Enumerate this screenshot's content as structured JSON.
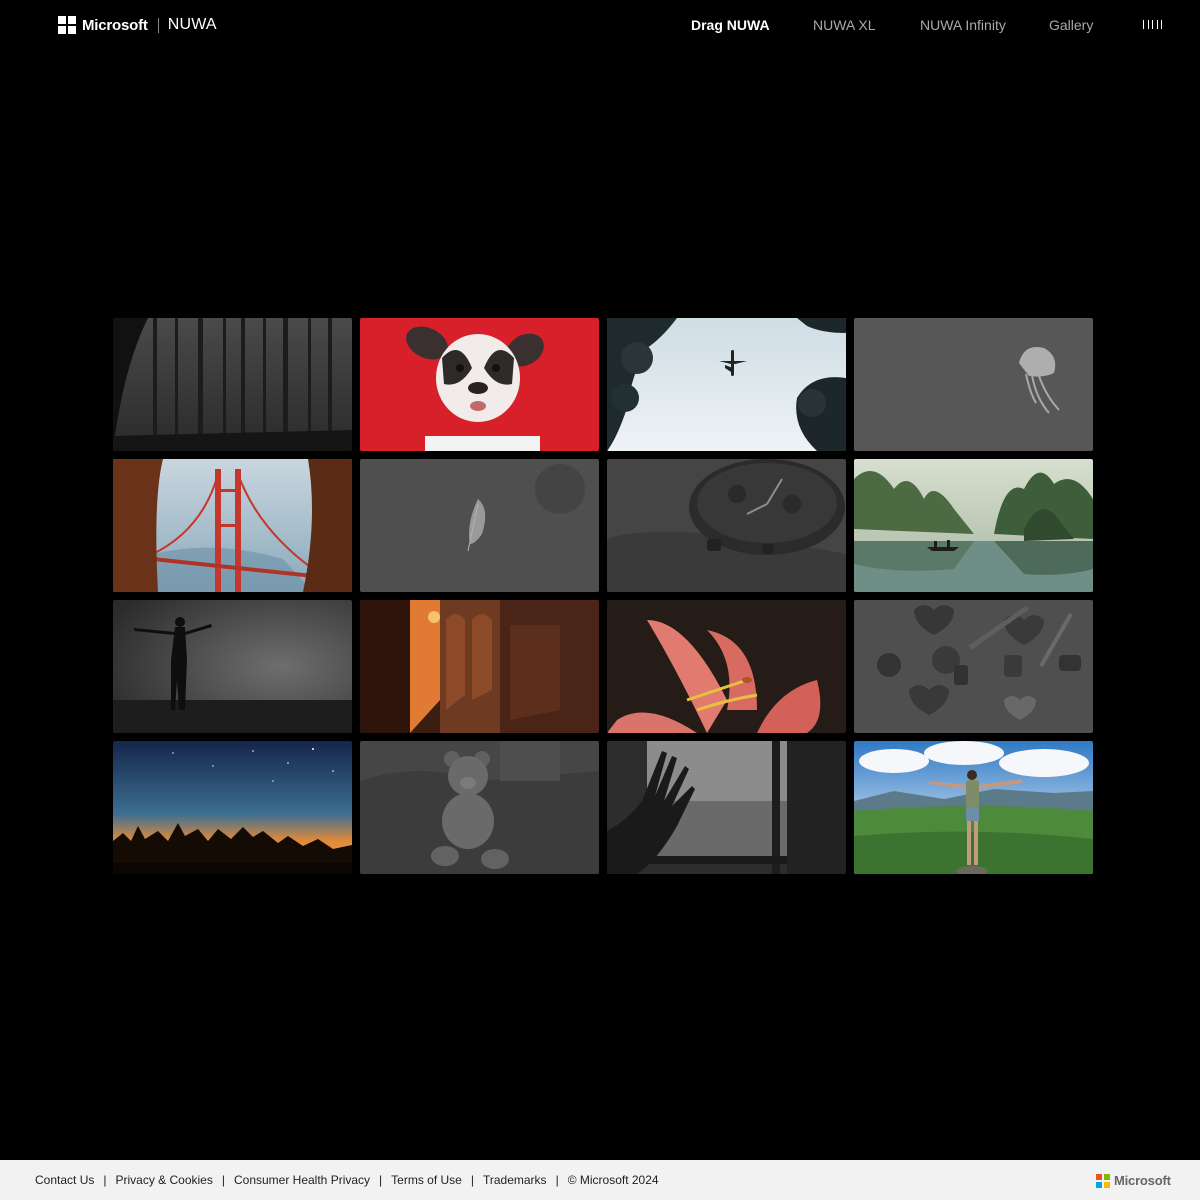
{
  "header": {
    "brand": "Microsoft",
    "product": "NUWA",
    "nav": [
      {
        "label": "Drag NUWA",
        "active": true
      },
      {
        "label": "NUWA XL",
        "active": false
      },
      {
        "label": "NUWA Infinity",
        "active": false
      },
      {
        "label": "Gallery",
        "active": false
      }
    ],
    "menu_icon": "menu-bars-icon"
  },
  "gallery": {
    "tiles": [
      "forest",
      "puppy",
      "airplane",
      "jellyfish",
      "golden-gate-bridge",
      "feather",
      "watch",
      "lake-boat",
      "silhouette",
      "sunset-corridor",
      "lily-flower",
      "candies",
      "starry-sunset",
      "teddy-bear",
      "hand-window",
      "man-mountains"
    ]
  },
  "footer": {
    "links": [
      "Contact Us",
      "Privacy & Cookies",
      "Consumer Health Privacy",
      "Terms of Use",
      "Trademarks"
    ],
    "copyright": "© Microsoft 2024",
    "logo_text": "Microsoft",
    "logo_colors": [
      "#f25022",
      "#7fba00",
      "#00a4ef",
      "#ffb900"
    ]
  }
}
